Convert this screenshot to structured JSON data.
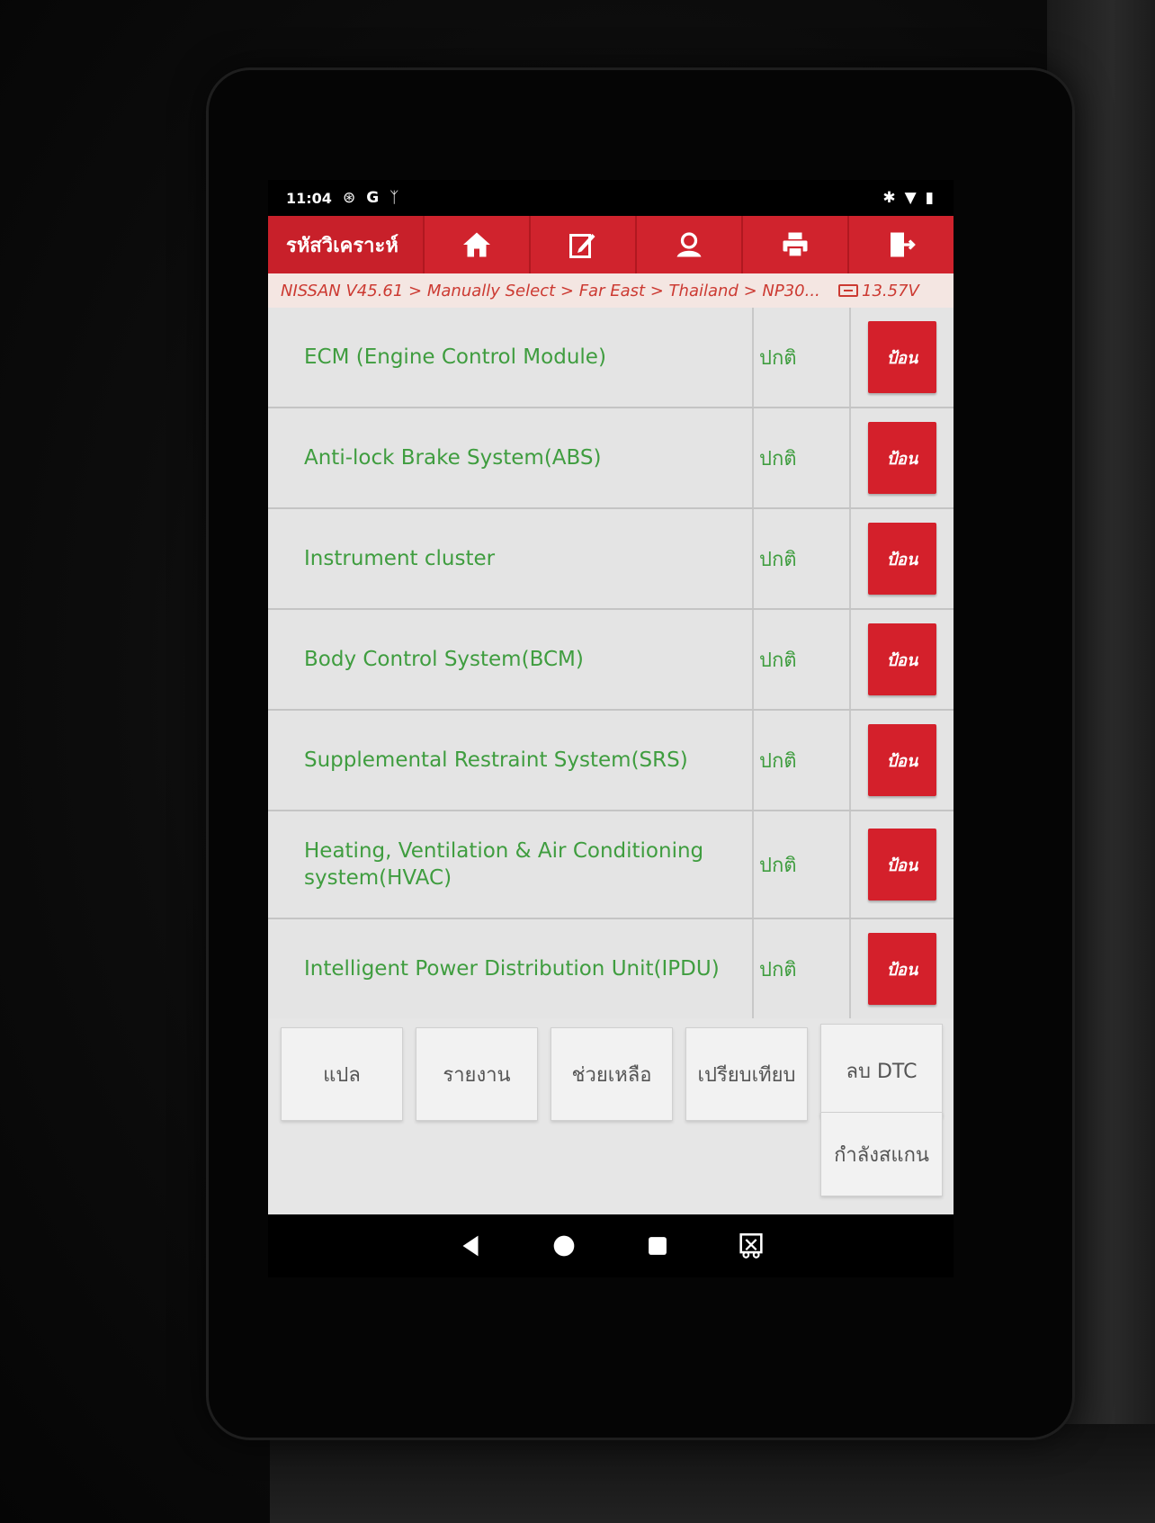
{
  "status_bar": {
    "time": "11:04",
    "left_icons": [
      "bluetooth-circle-icon",
      "google-icon",
      "usb-debug-icon"
    ],
    "right_icons": [
      "bluetooth-icon",
      "wifi-icon",
      "battery-icon"
    ]
  },
  "app_bar": {
    "title": "รหัสวิเคราะห์",
    "tools": [
      "home-icon",
      "edit-icon",
      "user-icon",
      "print-icon",
      "exit-icon"
    ]
  },
  "breadcrumb": {
    "path": "NISSAN V45.61 > Manually Select > Far East > Thailand > NP30...",
    "voltage": "13.57V"
  },
  "modules": [
    {
      "name": "ECM (Engine Control Module)",
      "status": "ปกติ",
      "action": "ป้อน"
    },
    {
      "name": "Anti-lock Brake System(ABS)",
      "status": "ปกติ",
      "action": "ป้อน"
    },
    {
      "name": "Instrument cluster",
      "status": "ปกติ",
      "action": "ป้อน"
    },
    {
      "name": "Body Control System(BCM)",
      "status": "ปกติ",
      "action": "ป้อน"
    },
    {
      "name": "Supplemental Restraint System(SRS)",
      "status": "ปกติ",
      "action": "ป้อน"
    },
    {
      "name": "Heating, Ventilation & Air Conditioning system(HVAC)",
      "status": "ปกติ",
      "action": "ป้อน"
    },
    {
      "name": "Intelligent Power Distribution Unit(IPDU)",
      "status": "ปกติ",
      "action": "ป้อน"
    }
  ],
  "function_buttons": {
    "translate": "แปล",
    "report": "รายงาน",
    "help": "ช่วยเหลือ",
    "compare": "เปรียบเทียบ",
    "clear_dtc": "ลบ DTC",
    "scanning": "กำลังสแกน"
  },
  "nav_bar": [
    "back-icon",
    "home-circle-icon",
    "recents-icon",
    "screenshot-icon"
  ],
  "colors": {
    "accent_red": "#c8202a",
    "status_green": "#3f9d3f",
    "breadcrumb_red": "#cc3a32"
  }
}
